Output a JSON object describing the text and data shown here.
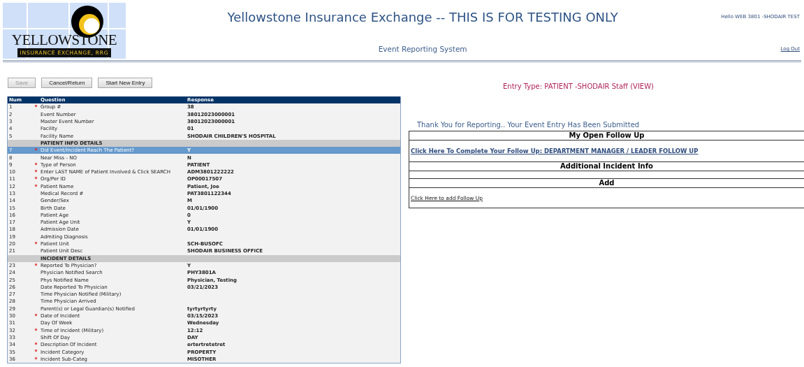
{
  "logo": {
    "name": "YELLOWSTONE",
    "tagline": "INSURANCE EXCHANGE, RRG"
  },
  "header": {
    "title": "Yellowstone Insurance Exchange -- THIS IS FOR TESTING ONLY",
    "subtitle": "Event Reporting System",
    "greeting": "Hello WEB 3801 -SHODAIR TEST",
    "logout": "Log Out"
  },
  "toolbar": [
    {
      "label": "Save",
      "disabled": true
    },
    {
      "label": "Cancel/Return",
      "disabled": false
    },
    {
      "label": "Start New Entry",
      "disabled": false
    }
  ],
  "table": {
    "columns": [
      "Num",
      "Question",
      "Response"
    ],
    "rows": [
      {
        "kind": "item",
        "num": "1",
        "question": "Group #",
        "response": "38",
        "required": true,
        "selected": false
      },
      {
        "kind": "item",
        "num": "2",
        "question": "Event Number",
        "response": "38012023000001",
        "required": false,
        "selected": false
      },
      {
        "kind": "item",
        "num": "3",
        "question": "Master Event Number",
        "response": "38012023000001",
        "required": false,
        "selected": false
      },
      {
        "kind": "item",
        "num": "4",
        "question": "Facility",
        "response": "01",
        "required": false,
        "selected": false
      },
      {
        "kind": "item",
        "num": "5",
        "question": "Facility Name",
        "response": "SHODAIR CHILDREN'S HOSPITAL",
        "required": false,
        "selected": false
      },
      {
        "kind": "section",
        "question": "PATIENT INFO DETAILS"
      },
      {
        "kind": "item",
        "num": "7",
        "question": "Did Event/Incident Reach The Patient?",
        "response": "Y",
        "required": true,
        "selected": true
      },
      {
        "kind": "item",
        "num": "8",
        "question": "Near Miss - NO",
        "response": "N",
        "required": false,
        "selected": false
      },
      {
        "kind": "item",
        "num": "9",
        "question": "Type of Person",
        "response": "PATIENT",
        "required": true,
        "selected": false
      },
      {
        "kind": "item",
        "num": "10",
        "question": "Enter LAST NAME of Patient Involved & Click SEARCH",
        "response": "ADM3801222222",
        "required": true,
        "selected": false
      },
      {
        "kind": "item",
        "num": "11",
        "question": "Org/Per ID",
        "response": "OP00017507",
        "required": true,
        "selected": false
      },
      {
        "kind": "item",
        "num": "12",
        "question": "Patient Name",
        "response": "Patient, Joe",
        "required": true,
        "selected": false
      },
      {
        "kind": "item",
        "num": "13",
        "question": "Medical Record #",
        "response": "PAT3801122344",
        "required": false,
        "selected": false
      },
      {
        "kind": "item",
        "num": "14",
        "question": "Gender/Sex",
        "response": "M",
        "required": false,
        "selected": false
      },
      {
        "kind": "item",
        "num": "15",
        "question": "Birth Date",
        "response": "01/01/1900",
        "required": false,
        "selected": false
      },
      {
        "kind": "item",
        "num": "16",
        "question": "Patient Age",
        "response": "0",
        "required": false,
        "selected": false
      },
      {
        "kind": "item",
        "num": "17",
        "question": "Patient Age Unit",
        "response": "Y",
        "required": false,
        "selected": false
      },
      {
        "kind": "item",
        "num": "18",
        "question": "Admission Date",
        "response": "01/01/1900",
        "required": false,
        "selected": false
      },
      {
        "kind": "item",
        "num": "19",
        "question": "Admiting Diagnosis",
        "required": false,
        "selected": false
      },
      {
        "kind": "item",
        "num": "20",
        "question": "Patient Unit",
        "response": "SCH-BUSOFC",
        "required": true,
        "selected": false
      },
      {
        "kind": "item",
        "num": "21",
        "question": "Patient Unit Desc",
        "response": "SHODAIR BUSINESS OFFICE",
        "required": false,
        "selected": false
      },
      {
        "kind": "section",
        "question": "INCIDENT DETAILS"
      },
      {
        "kind": "item",
        "num": "23",
        "question": "Reported To Physician?",
        "response": "Y",
        "required": true,
        "selected": false
      },
      {
        "kind": "item",
        "num": "24",
        "question": "Physician Notified Search",
        "response": "PHY3801A",
        "required": false,
        "selected": false
      },
      {
        "kind": "item",
        "num": "25",
        "question": "Phys Notified Name",
        "response": "Physician, Testing",
        "required": false,
        "selected": false
      },
      {
        "kind": "item",
        "num": "26",
        "question": "Date Reported To Physician",
        "response": "03/21/2023",
        "required": false,
        "selected": false
      },
      {
        "kind": "item",
        "num": "27",
        "question": "Time Physician Notified (Military)",
        "required": false,
        "selected": false
      },
      {
        "kind": "item",
        "num": "28",
        "question": "Time Physician Arrived",
        "required": false,
        "selected": false
      },
      {
        "kind": "item",
        "num": "29",
        "question": "Parent(s) or Legal Guardian(s) Notified",
        "response": "tyrtyrtyrty",
        "required": false,
        "selected": false
      },
      {
        "kind": "item",
        "num": "30",
        "question": "Date of Incident",
        "response": "03/15/2023",
        "required": true,
        "selected": false
      },
      {
        "kind": "item",
        "num": "31",
        "question": "Day Of Week",
        "response": "Wednesday",
        "required": false,
        "selected": false
      },
      {
        "kind": "item",
        "num": "32",
        "question": "Time of Incident (Military)",
        "response": "12:12",
        "required": true,
        "selected": false
      },
      {
        "kind": "item",
        "num": "33",
        "question": "Shift Of Day",
        "response": "DAY",
        "required": false,
        "selected": false
      },
      {
        "kind": "item",
        "num": "34",
        "question": "Description Of Incident",
        "response": "ertertretetret",
        "required": true,
        "selected": false
      },
      {
        "kind": "item",
        "num": "35",
        "question": "Incident Category",
        "response": "PROPERTY",
        "required": true,
        "selected": false
      },
      {
        "kind": "item",
        "num": "36",
        "question": "Incident Sub-Categ",
        "response": "MISOTHER",
        "required": true,
        "selected": false
      }
    ]
  },
  "entry_type": "Entry Type: PATIENT -SHODAIR Staff (VIEW)",
  "confirmation": "Thank You for Reporting.. Your Event Entry Has Been Submitted",
  "followup": [
    {
      "heading": "My Open Follow Up",
      "link": "Click Here To Complete Your Follow Up: DEPARTMENT MANAGER / LEADER FOLLOW UP",
      "kind": "large"
    },
    {
      "heading": "Additional Incident Info",
      "kind": "empty"
    },
    {
      "heading": "Add",
      "link": "Click Here to add Follow Up",
      "kind": "small"
    }
  ]
}
